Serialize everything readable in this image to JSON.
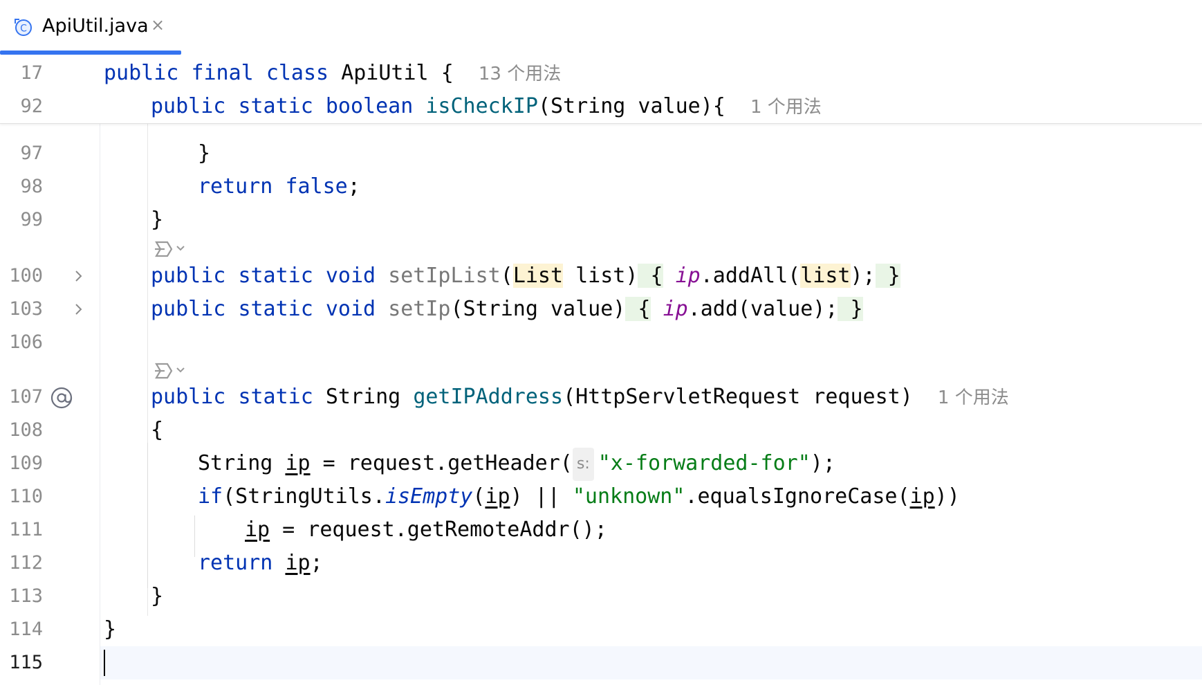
{
  "tab": {
    "file_name": "ApiUtil.java",
    "close_glyph": "×",
    "icon": "java-class-icon",
    "accent": "#3574f0"
  },
  "sticky": {
    "l1": {
      "num": "17",
      "kw1": "public",
      "kw2": "final",
      "kw3": "class",
      "name": "ApiUtil",
      "brace": "{",
      "hint": "13 个用法"
    },
    "l2": {
      "num": "92",
      "kw1": "public",
      "kw2": "static",
      "kw3": "boolean",
      "fn": "isCheckIP",
      "params": "(String value){",
      "hint": "1 个用法"
    }
  },
  "lines": {
    "l97": {
      "num": "97",
      "text": "}"
    },
    "l98": {
      "num": "98",
      "kw": "return",
      "kw2": "false",
      "rest": ";"
    },
    "l99": {
      "num": "99",
      "text": "}"
    },
    "l100": {
      "num": "100",
      "kw1": "public",
      "kw2": "static",
      "kw3": "void",
      "fn": "setIpList",
      "p1": "(",
      "type": "List",
      "p2": " list",
      "p3": ")",
      "b1": " {",
      "field": "ip",
      "call": ".addAll(",
      "arg": "list",
      "end": ");",
      "b2": " }"
    },
    "l103": {
      "num": "103",
      "kw1": "public",
      "kw2": "static",
      "kw3": "void",
      "fn": "setIp",
      "params": "(String value)",
      "b1": " {",
      "field": "ip",
      "call": ".add(value);",
      "b2": " }"
    },
    "l106": {
      "num": "106"
    },
    "l107": {
      "num": "107",
      "kw1": "public",
      "kw2": "static",
      "type": "String",
      "fn": "getIPAddress",
      "params": "(HttpServletRequest request)",
      "hint": "1 个用法"
    },
    "l108": {
      "num": "108",
      "text": "{"
    },
    "l109": {
      "num": "109",
      "type": "String",
      "var": "ip",
      "mid": " = request.getHeader(",
      "plabel": "s:",
      "str": "\"x-forwarded-for\"",
      "end": ");"
    },
    "l110": {
      "num": "110",
      "kw": "if",
      "a": "(StringUtils.",
      "italic": "isEmpty",
      "b": "(",
      "var": "ip",
      "c": ") || ",
      "str": "\"unknown\"",
      "d": ".equalsIgnoreCase(",
      "var2": "ip",
      "e": "))"
    },
    "l111": {
      "num": "111",
      "var": "ip",
      "rest": " = request.getRemoteAddr();"
    },
    "l112": {
      "num": "112",
      "kw": "return",
      "var": "ip",
      "rest": ";"
    },
    "l113": {
      "num": "113",
      "text": "}"
    },
    "l114": {
      "num": "114",
      "text": "}"
    },
    "l115": {
      "num": "115"
    }
  },
  "gutter_icons": {
    "fold": "chevron-right-icon",
    "override": "at-sign-icon",
    "ai": "ai-assistant-icon"
  }
}
